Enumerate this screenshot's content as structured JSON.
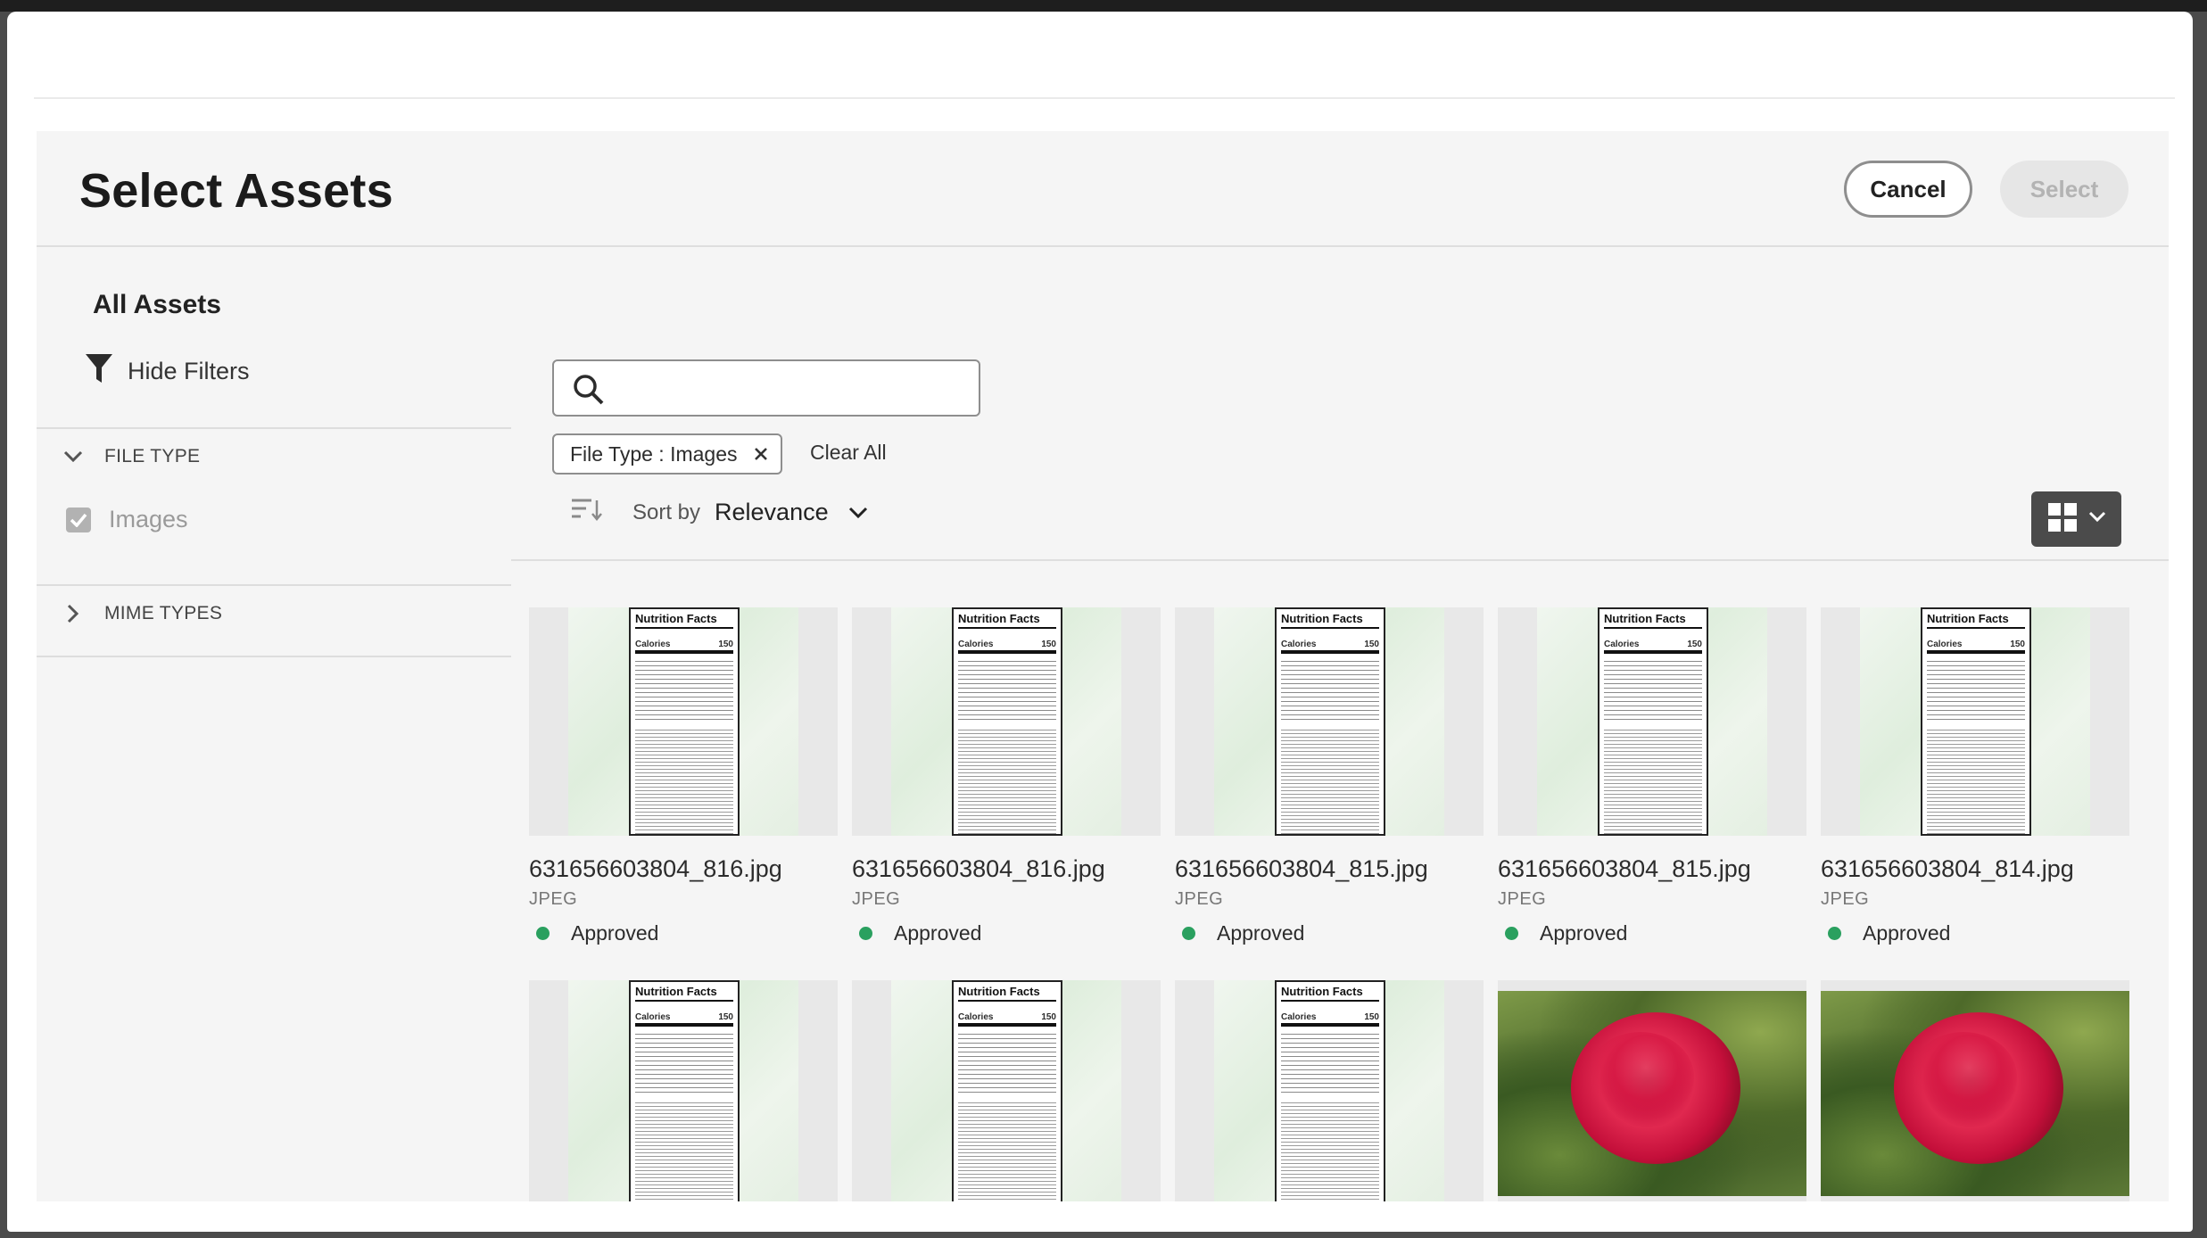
{
  "dialog": {
    "title": "Select Assets",
    "cancel_label": "Cancel",
    "select_label": "Select"
  },
  "sidebar": {
    "heading": "All Assets",
    "hide_filters_label": "Hide Filters",
    "sections": [
      {
        "label": "FILE TYPE",
        "expanded": true,
        "options": [
          {
            "label": "Images",
            "checked": true
          }
        ]
      },
      {
        "label": "MIME TYPES",
        "expanded": false
      }
    ]
  },
  "toolbar": {
    "search": {
      "value": "",
      "placeholder": ""
    },
    "filter_chip": "File Type : Images",
    "clear_all_label": "Clear All",
    "sort_by_label": "Sort by",
    "sort_value": "Relevance",
    "view_mode": "grid"
  },
  "assets": [
    {
      "name": "631656603804_816.jpg",
      "type": "JPEG",
      "status": "Approved",
      "thumb": "nutrition-facts"
    },
    {
      "name": "631656603804_816.jpg",
      "type": "JPEG",
      "status": "Approved",
      "thumb": "nutrition-facts"
    },
    {
      "name": "631656603804_815.jpg",
      "type": "JPEG",
      "status": "Approved",
      "thumb": "nutrition-facts"
    },
    {
      "name": "631656603804_815.jpg",
      "type": "JPEG",
      "status": "Approved",
      "thumb": "nutrition-facts"
    },
    {
      "name": "631656603804_814.jpg",
      "type": "JPEG",
      "status": "Approved",
      "thumb": "nutrition-facts"
    }
  ],
  "assets_row2": [
    {
      "thumb": "nutrition-facts"
    },
    {
      "thumb": "nutrition-facts"
    },
    {
      "thumb": "nutrition-facts"
    },
    {
      "thumb": "red-rose"
    },
    {
      "thumb": "red-rose"
    }
  ],
  "nutrition_label": {
    "heading": "Nutrition Facts",
    "calories_label": "Calories",
    "calories_value": "150"
  },
  "colors": {
    "approved": "#2aa05f",
    "primary_button": "#4b4b4b"
  }
}
